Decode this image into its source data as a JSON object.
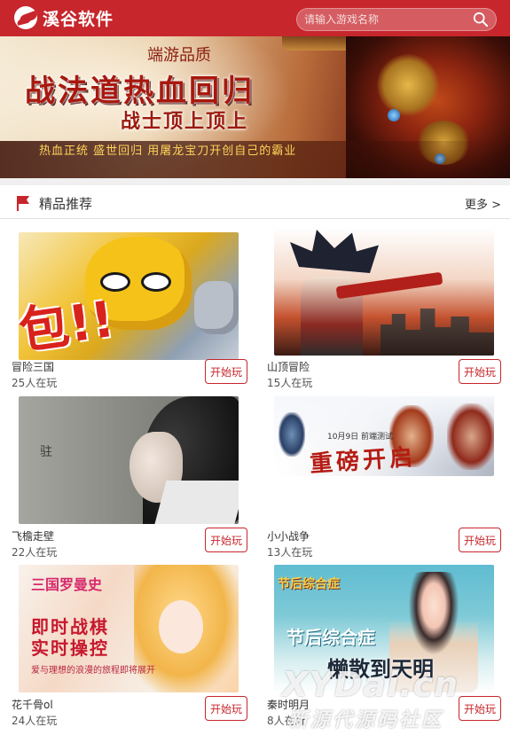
{
  "header": {
    "logo_text": "溪谷软件",
    "search_placeholder": "请输入游戏名称"
  },
  "banner": {
    "subtitle": "端游品质",
    "title": "战法道热血回归",
    "title2": "战士顶上顶上",
    "slogan": "热血正统  盛世回归   用屠龙宝刀开创自己的霸业",
    "slide_count": 4,
    "active_slide": 4
  },
  "section": {
    "title": "精品推荐",
    "more": "更多 >"
  },
  "games": [
    {
      "name": "冒险三国",
      "players": "25人在玩",
      "button": "开始玩",
      "art": {
        "text": "包!!"
      }
    },
    {
      "name": "山顶冒险",
      "players": "15人在玩",
      "button": "开始玩"
    },
    {
      "name": "飞檐走壁",
      "players": "22人在玩",
      "button": "开始玩",
      "art": {
        "text": "驻"
      }
    },
    {
      "name": "小小战争",
      "players": "13人在玩",
      "button": "开始玩",
      "art": {
        "date": "10月9日  前端测试",
        "text": "重磅开启"
      }
    },
    {
      "name": "花千骨ol",
      "players": "24人在玩",
      "button": "开始玩",
      "art": {
        "logo": "三国罗曼史",
        "line1": "即时战棋",
        "line2": "实时操控",
        "line3": "爱与理想的浪漫的旅程即将展开"
      }
    },
    {
      "name": "秦时明月",
      "players": "8人在玩",
      "button": "开始玩",
      "art": {
        "logo": "节后综合症",
        "line1": "节后综合症",
        "line2": "懒散到天明"
      }
    }
  ],
  "watermark": {
    "line1": "XYDai.cn",
    "line2": "新源代源码社区"
  },
  "colors": {
    "brand_red": "#c7262c",
    "button_border": "#c7262c",
    "dot_active": "#3fb2e6"
  }
}
